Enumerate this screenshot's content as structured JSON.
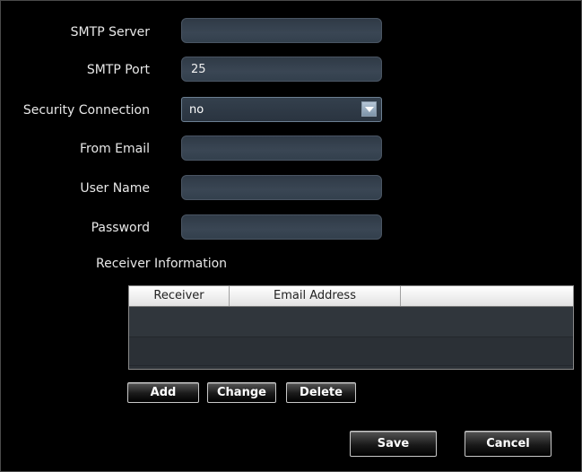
{
  "form": {
    "smtp_server": {
      "label": "SMTP Server",
      "value": ""
    },
    "smtp_port": {
      "label": "SMTP Port",
      "value": "25"
    },
    "security": {
      "label": "Security Connection",
      "value": "no"
    },
    "from_email": {
      "label": "From Email",
      "value": ""
    },
    "user_name": {
      "label": "User Name",
      "value": ""
    },
    "password": {
      "label": "Password",
      "value": ""
    }
  },
  "receiver": {
    "section_title": "Receiver Information",
    "columns": [
      "Receiver",
      "Email Address",
      ""
    ],
    "rows": []
  },
  "actions": {
    "add": "Add",
    "change": "Change",
    "delete": "Delete",
    "save": "Save",
    "cancel": "Cancel"
  }
}
